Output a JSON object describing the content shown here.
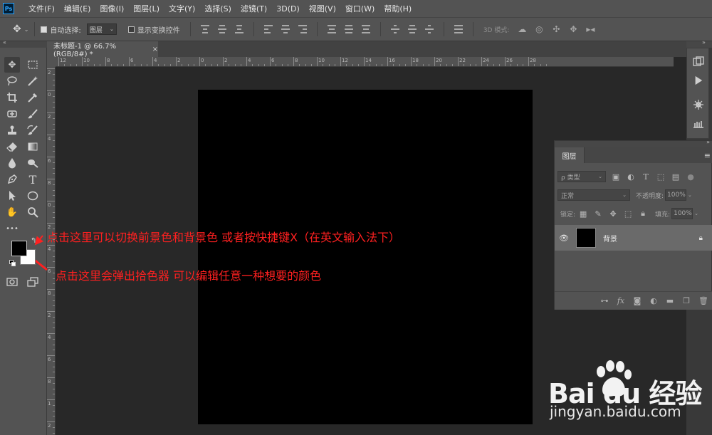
{
  "app": {
    "logo": "Ps"
  },
  "menu": [
    "文件(F)",
    "编辑(E)",
    "图像(I)",
    "图层(L)",
    "文字(Y)",
    "选择(S)",
    "滤镜(T)",
    "3D(D)",
    "视图(V)",
    "窗口(W)",
    "帮助(H)"
  ],
  "options": {
    "auto_select_label": "自动选择:",
    "auto_select_value": "图层",
    "show_transform_label": "显示变换控件",
    "mode3d_label": "3D 模式:"
  },
  "document": {
    "tab_title": "未标题-1 @ 66.7%(RGB/8#) *",
    "close": "×",
    "ruler_h_labels": [
      "12",
      "10",
      "8",
      "6",
      "4",
      "2",
      "0",
      "2",
      "4",
      "6",
      "8",
      "10",
      "12",
      "14",
      "16",
      "18",
      "20",
      "22",
      "24",
      "26",
      "28"
    ],
    "ruler_v_labels": [
      "2",
      "0",
      "2",
      "4",
      "6",
      "8",
      "0",
      "2",
      "4",
      "6",
      "8",
      "2",
      "4",
      "6",
      "8",
      "1",
      "2"
    ]
  },
  "tools": {
    "more": "•••"
  },
  "layers": {
    "tab": "图层",
    "filter_kind": "ρ 类型",
    "blend_mode": "正常",
    "opacity_label": "不透明度:",
    "opacity_value": "100%",
    "lock_label": "锁定:",
    "fill_label": "填充:",
    "fill_value": "100%",
    "layer_name": "背景"
  },
  "annotations": {
    "swap_hint": "点击这里可以切换前景色和背景色 或者按快捷键X（在英文输入法下）",
    "picker_hint": "点击这里会弹出拾色器 可以编辑任意一种想要的颜色"
  },
  "watermark": {
    "logo_text": "Bai du 经验",
    "url": "jingyan.baidu.com"
  },
  "colors": {
    "foreground": "#000000",
    "background": "#ffffff",
    "annotation": "#ff2020"
  }
}
